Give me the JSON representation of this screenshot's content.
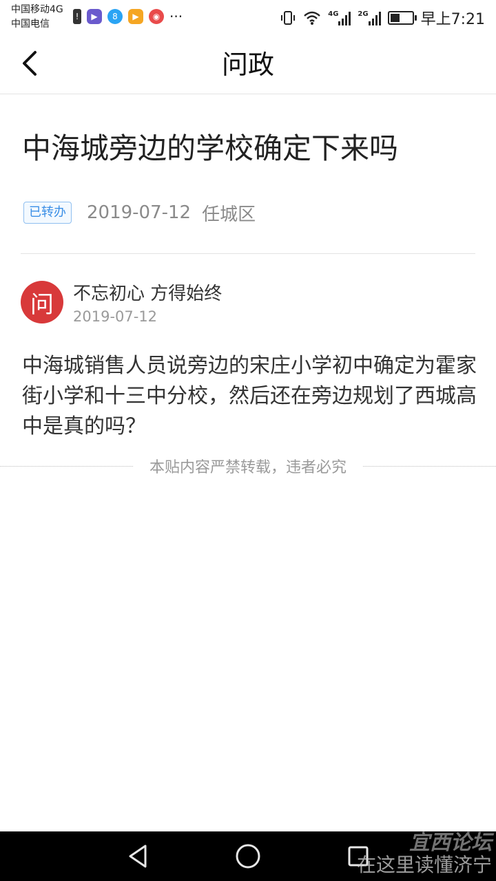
{
  "status_bar": {
    "carrier_1": "中国移动4G",
    "carrier_2": "中国电信",
    "time": "早上7:21",
    "net_1": "4G",
    "net_2": "2G",
    "battery_level": 0.45,
    "more": "···"
  },
  "header": {
    "title": "问政"
  },
  "question": {
    "title": "中海城旁边的学校确定下来吗",
    "status_badge": "已转办",
    "date": "2019-07-12",
    "area": "任城区"
  },
  "author": {
    "avatar_text": "问",
    "name": "不忘初心 方得始终",
    "date": "2019-07-12"
  },
  "content": "中海城销售人员说旁边的宋庄小学初中确定为霍家街小学和十三中分校，然后还在旁边规划了西城高中是真的吗？",
  "notice": "本贴内容严禁转载，违者必究",
  "watermark": {
    "line1": "宜西论坛",
    "line2": "在这里读懂济宁"
  },
  "colors": {
    "badge": "#3a8ee6",
    "avatar": "#d8393a",
    "accent_app_1": "#6a5acd",
    "accent_app_2": "#2aa4f4",
    "accent_app_3": "#f5a623",
    "accent_app_4": "#e94b4b"
  }
}
